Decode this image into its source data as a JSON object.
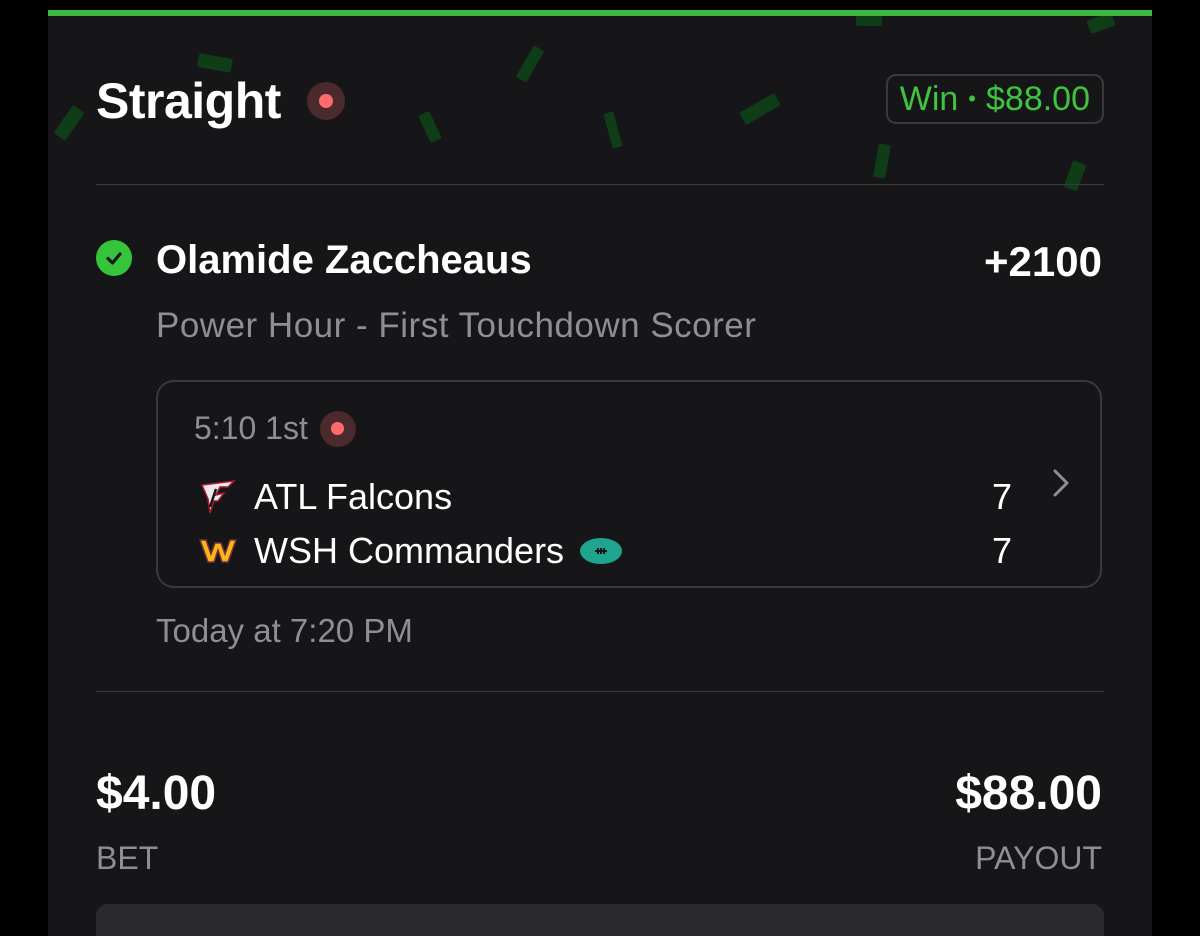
{
  "bet_type": "Straight",
  "status_badge": {
    "result": "Win",
    "separator": "•",
    "amount": "$88.00"
  },
  "selection": {
    "player": "Olamide Zaccheaus",
    "odds": "+2100",
    "market": "Power Hour - First Touchdown Scorer"
  },
  "game": {
    "clock": "5:10 1st",
    "teams": [
      {
        "name": "ATL Falcons",
        "score": "7",
        "logo": "falcons-logo-icon"
      },
      {
        "name": "WSH Commanders",
        "score": "7",
        "logo": "commanders-logo-icon",
        "possession": true
      }
    ],
    "start_time": "Today at 7:20 PM"
  },
  "wager": {
    "bet_amount": "$4.00",
    "bet_label": "BET",
    "payout_amount": "$88.00",
    "payout_label": "PAYOUT"
  },
  "colors": {
    "accent_green": "#3fc43f",
    "live_red": "#ff6b6b",
    "possession_teal": "#1fa48f"
  }
}
